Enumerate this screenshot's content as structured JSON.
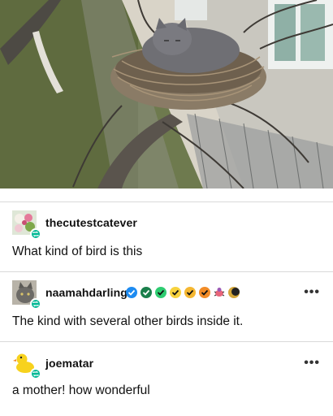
{
  "image": {
    "description_icon": "cat-in-nest-photo"
  },
  "posts": [
    {
      "username": "thecutestcatever",
      "text": "What kind of bird is this",
      "avatar_icon": "flowers-avatar-icon",
      "badge_icon": "reblog-icon"
    },
    {
      "username": "naamahdarling",
      "text": "The kind with several other birds inside it.",
      "avatar_icon": "cat-avatar-icon",
      "badge_icon": "reblog-icon",
      "verified_badges": [
        "blue",
        "green",
        "green",
        "yellow",
        "yellow",
        "orange",
        "pink-bug",
        "moon"
      ],
      "more_label": "•••"
    },
    {
      "username": "joematar",
      "text": "a mother! how wonderful",
      "avatar_icon": "rubber-duck-avatar-icon",
      "badge_icon": "reblog-icon",
      "more_label": "•••"
    }
  ],
  "colors": {
    "reblog_green": "#00b894",
    "divider": "#d9d9d9"
  }
}
